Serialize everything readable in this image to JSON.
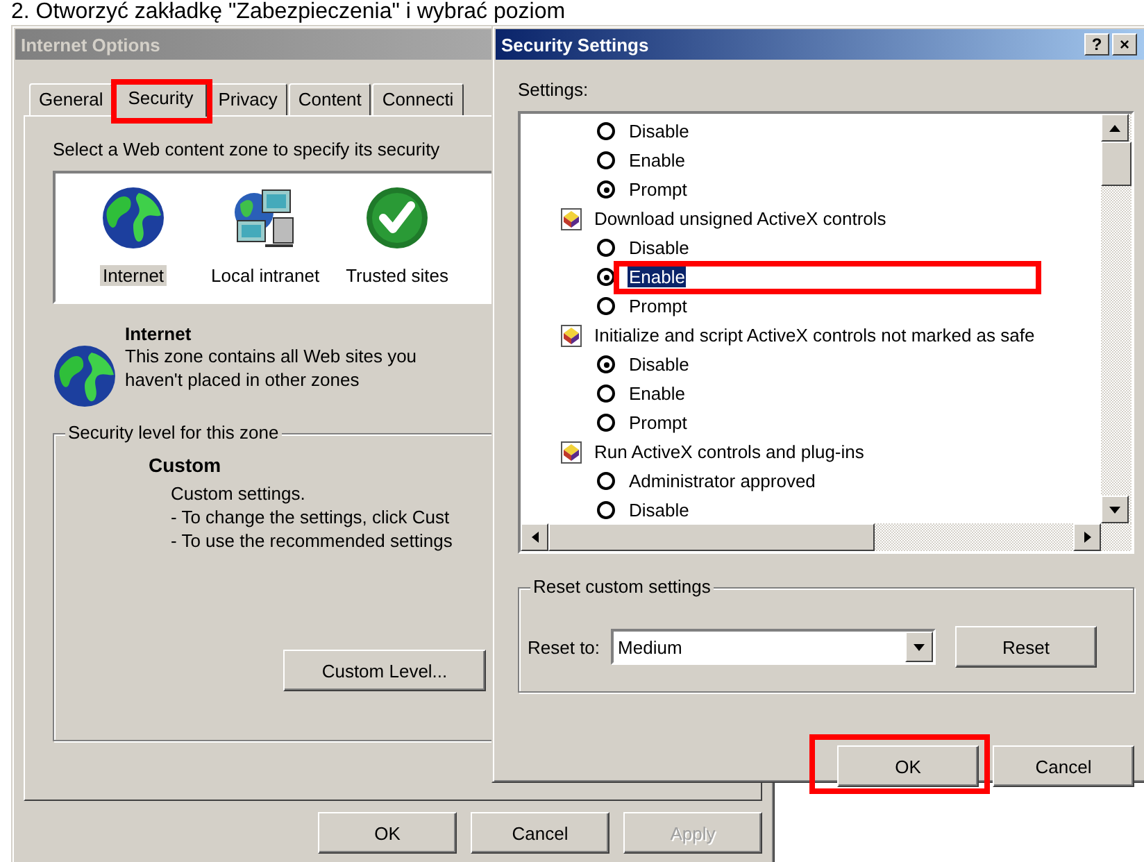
{
  "heading": "2.  Otworzyć zakładkę \"Zabezpieczenia\" i wybrać poziom",
  "internet_options": {
    "title": "Internet Options",
    "tabs": [
      {
        "label": "General",
        "selected": false,
        "annotated": false
      },
      {
        "label": "Security",
        "selected": true,
        "annotated": true
      },
      {
        "label": "Privacy",
        "selected": false,
        "annotated": false
      },
      {
        "label": "Content",
        "selected": false,
        "annotated": false
      },
      {
        "label": "Connecti",
        "selected": false,
        "annotated": false
      }
    ],
    "zone_prompt": "Select a Web content zone to specify its security",
    "zones": [
      {
        "kind": "globe",
        "label": "Internet",
        "selected": true
      },
      {
        "kind": "intranet",
        "label": "Local intranet",
        "selected": false
      },
      {
        "kind": "trusted",
        "label": "Trusted sites",
        "selected": false
      }
    ],
    "zone_name": "Internet",
    "zone_description": "This zone contains all Web sites you haven't placed in other zones",
    "group_label": "Security level for this zone",
    "level_name": "Custom",
    "level_lines": [
      "Custom settings.",
      "- To change the settings, click Cust",
      "- To use the recommended settings"
    ],
    "custom_level_button": "Custom Level...",
    "buttons": [
      {
        "label": "OK",
        "disabled": false
      },
      {
        "label": "Cancel",
        "disabled": false
      },
      {
        "label": "Apply",
        "disabled": true
      }
    ]
  },
  "security_settings": {
    "title": "Security Settings",
    "help_button": "?",
    "close_button": "×",
    "settings_label": "Settings:",
    "settings": [
      {
        "kind": "option",
        "label": "Disable",
        "selected": false,
        "focused": false,
        "annotated": false
      },
      {
        "kind": "option",
        "label": "Enable",
        "selected": false,
        "focused": false,
        "annotated": false
      },
      {
        "kind": "option",
        "label": "Prompt",
        "selected": true,
        "focused": false,
        "annotated": false
      },
      {
        "kind": "header",
        "label": "Download unsigned ActiveX controls"
      },
      {
        "kind": "option",
        "label": "Disable",
        "selected": false,
        "focused": false,
        "annotated": false
      },
      {
        "kind": "option",
        "label": "Enable",
        "selected": true,
        "focused": true,
        "annotated": true
      },
      {
        "kind": "option",
        "label": "Prompt",
        "selected": false,
        "focused": false,
        "annotated": false
      },
      {
        "kind": "header",
        "label": "Initialize and script ActiveX controls not marked as safe"
      },
      {
        "kind": "option",
        "label": "Disable",
        "selected": true,
        "focused": false,
        "annotated": false
      },
      {
        "kind": "option",
        "label": "Enable",
        "selected": false,
        "focused": false,
        "annotated": false
      },
      {
        "kind": "option",
        "label": "Prompt",
        "selected": false,
        "focused": false,
        "annotated": false
      },
      {
        "kind": "header",
        "label": "Run ActiveX controls and plug-ins"
      },
      {
        "kind": "option",
        "label": "Administrator approved",
        "selected": false,
        "focused": false,
        "annotated": false
      },
      {
        "kind": "option",
        "label": "Disable",
        "selected": false,
        "focused": false,
        "annotated": false
      }
    ],
    "reset_group_label": "Reset custom settings",
    "reset_to_label": "Reset to:",
    "reset_to_value": "Medium",
    "reset_button": "Reset",
    "buttons": [
      {
        "label": "OK",
        "annotated": true
      },
      {
        "label": "Cancel",
        "annotated": false
      }
    ]
  }
}
